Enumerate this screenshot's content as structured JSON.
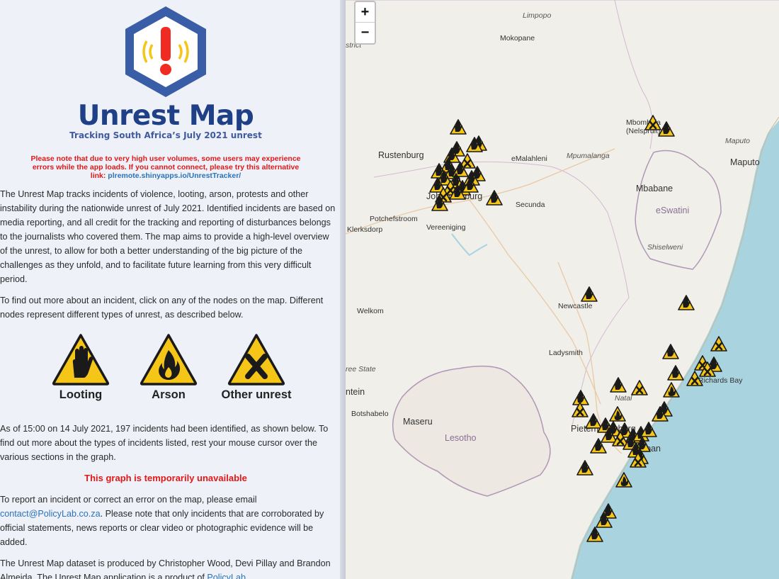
{
  "app": {
    "title": "Unrest Map",
    "subtitle": "Tracking South Africa’s July 2021 unrest"
  },
  "notice": {
    "text": "Please note that due to very high user volumes, some users may experience errors while the app loads. If you cannot connect, please try this alternative link:",
    "link": "plremote.shinyapps.io/UnrestTracker/"
  },
  "intro": {
    "p1": "The Unrest Map tracks incidents of violence, looting, arson, protests and other instability during the nationwide unrest of July 2021. Identified incidents are based on media reporting, and all credit for the tracking and reporting of disturbances belongs to the journalists who covered them. The map aims to provide a high-level overview of the unrest, to allow for both a better understanding of the big picture of the challenges as they unfold, and to facilitate future learning from this very difficult period.",
    "p2": "To find out more about an incident, click on any of the nodes on the map. Different nodes represent different types of unrest, as described below."
  },
  "legend": [
    {
      "label": "Looting",
      "icon": "hand-icon"
    },
    {
      "label": "Arson",
      "icon": "flame-icon"
    },
    {
      "label": "Other unrest",
      "icon": "x-icon"
    }
  ],
  "stats": {
    "p3": "As of 15:00 on 14 July 2021, 197 incidents had been identified, as shown below. To find out more about the types of incidents listed, rest your mouse cursor over the various sections in the graph.",
    "graph_unavailable": "This graph is temporarily unavailable"
  },
  "report": {
    "text_before": "To report an incident or correct an error on the map, please email",
    "email": "contact@PolicyLab.co.za",
    "text_after": ". Please note that only incidents that are corroborated by official statements, news reports or clear video or photographic evidence will be added."
  },
  "credits": {
    "text_before": "The Unrest Map dataset is produced by Christopher Wood, Devi Pillay and Brandon Almeida. The Unrest Map application is a product of",
    "link": "PolicyLab"
  },
  "map": {
    "zoom_in": "+",
    "zoom_out": "−",
    "labels": {
      "limpopo": "Limpopo",
      "mokopane": "Mokopane",
      "strict": "strict",
      "mbombela": "Mbombela",
      "nelspruit": "(Nelspruit)",
      "rustenburg": "Rustenburg",
      "emalahleni": "eMalahleni",
      "mpumalanga": "Mpumalanga",
      "maputo_region": "Maputo",
      "maputo": "Maputo",
      "johannesburg": "Johannesburg",
      "secunda": "Secunda",
      "mbabane": "Mbabane",
      "eswatini": "eSwatini",
      "potchefstroom": "Potchefstroom",
      "klerksdorp": "Klerksdorp",
      "vereeniging": "Vereeniging",
      "shiselweni": "Shiselweni",
      "welkom": "Welkom",
      "newcastle": "Newcastle",
      "ladysmith": "Ladysmith",
      "free_state": "ree State",
      "richards_bay": "Richards Bay",
      "ntein": "ntein",
      "botshabelo": "Botshabelo",
      "natal": "Natal",
      "maseru": "Maseru",
      "lesotho": "Lesotho",
      "pietermaritzburg": "Pietermaritzburg",
      "durban": "Durban"
    },
    "incidents_total": 197
  },
  "colors": {
    "title": "#1f3f86",
    "notice": "#e01818",
    "link": "#2a73b8",
    "marker_fill": "#f5c518",
    "marker_border": "#1a1a1a",
    "ocean": "#a9d3df",
    "land": "#f1efe9"
  }
}
